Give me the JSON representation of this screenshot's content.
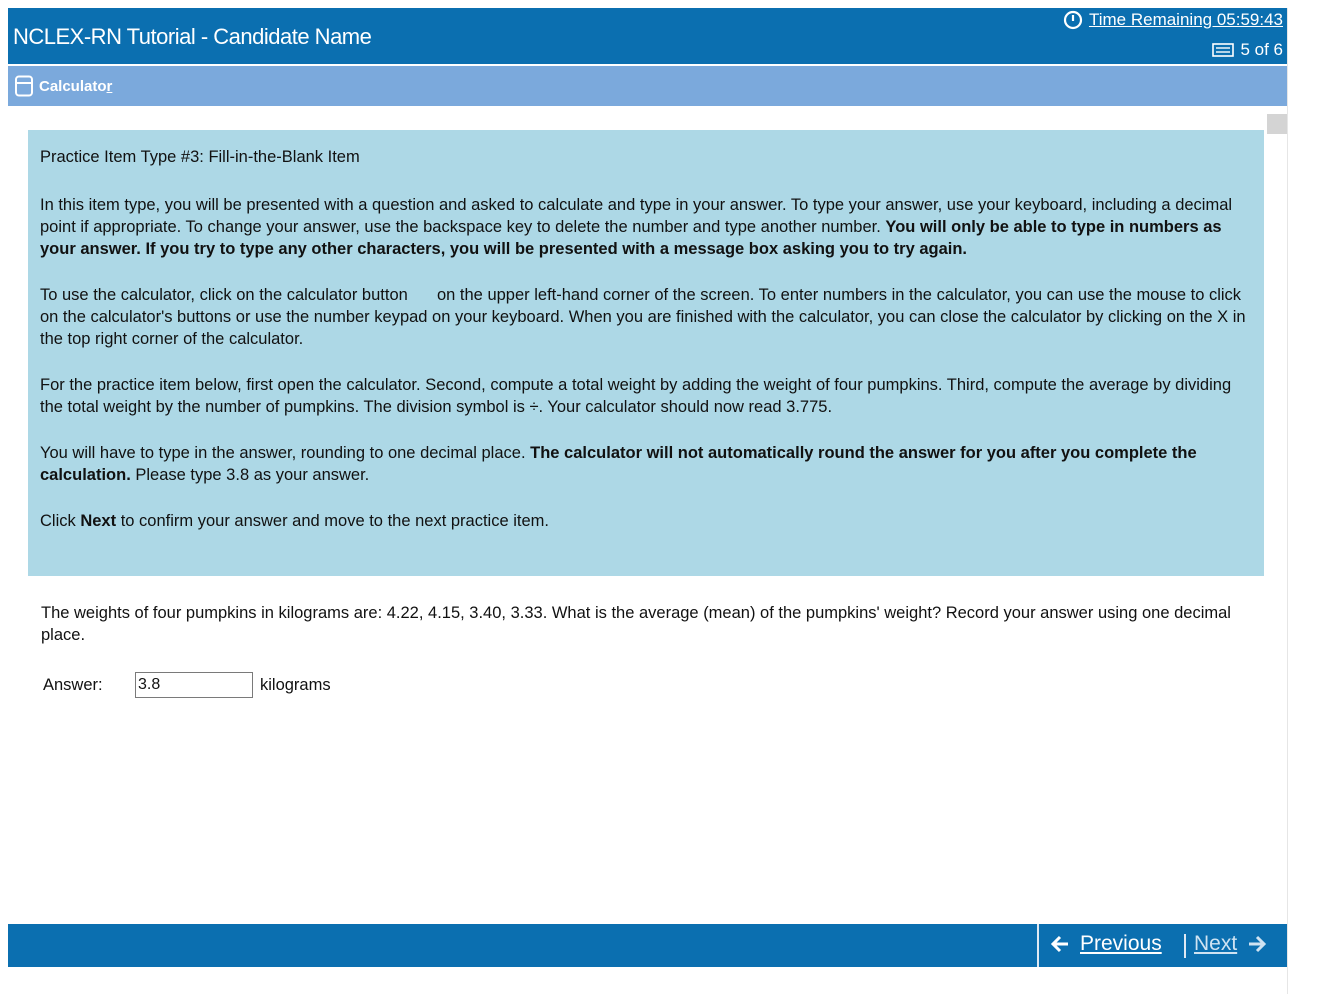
{
  "header": {
    "title": "NCLEX-RN Tutorial - Candidate Name",
    "time_label": "Time Remaining 05:59:43",
    "progress_label": "5 of 6"
  },
  "toolbar": {
    "calculator_label_main": "Calculato",
    "calculator_label_ul": "r"
  },
  "instructions": {
    "title": "Practice Item Type #3: Fill-in-the-Blank Item",
    "p1_a": "In this item type, you will be presented with a question and asked to calculate and type in your answer. To type your answer, use your keyboard, including a decimal point if appropriate. To change your answer, use the backspace key to delete the number and type another number.",
    "p1_bold": "You will only be able to type in numbers as your answer. If you try to type any other characters, you will be presented with a message box asking you to try again.",
    "p2_a": "To use the calculator, click on the calculator button",
    "p2_b": "on the upper left-hand corner of the screen. To enter numbers in the calculator, you can use the mouse to click on the calculator's buttons or use the number keypad on your keyboard. When you are finished with the calculator, you can close the calculator by clicking on the X in the top right corner of the calculator.",
    "p3_a": "For the practice item below, first open the calculator. Second, compute a total weight by adding the weight of four pumpkins. Third, compute the average by dividing the total weight by the number of pumpkins. The division symbol is ÷. Your calculator should now read 3.775.",
    "p4_a": "You will have to type in the answer, rounding to one decimal place.",
    "p4_bold": "The calculator will not automatically round the answer for you after you complete the calculation.",
    "p4_b": "Please type 3.8 as your answer.",
    "p5_a": "Click",
    "p5_bold": "Next",
    "p5_b": "to confirm your answer and move to the next practice item."
  },
  "question": {
    "text": "The weights of four pumpkins in kilograms are: 4.22, 4.15, 3.40, 3.33. What is the average (mean) of the pumpkins' weight? Record your answer using one decimal place."
  },
  "answer": {
    "label": "Answer:",
    "value": "3.8",
    "unit": "kilograms"
  },
  "footer": {
    "previous_label": "Previous",
    "next_label": "Next"
  },
  "colors": {
    "header_bg": "#0b6fb0",
    "toolbar_bg": "#7ba9dc",
    "instructions_bg": "#add8e6"
  }
}
